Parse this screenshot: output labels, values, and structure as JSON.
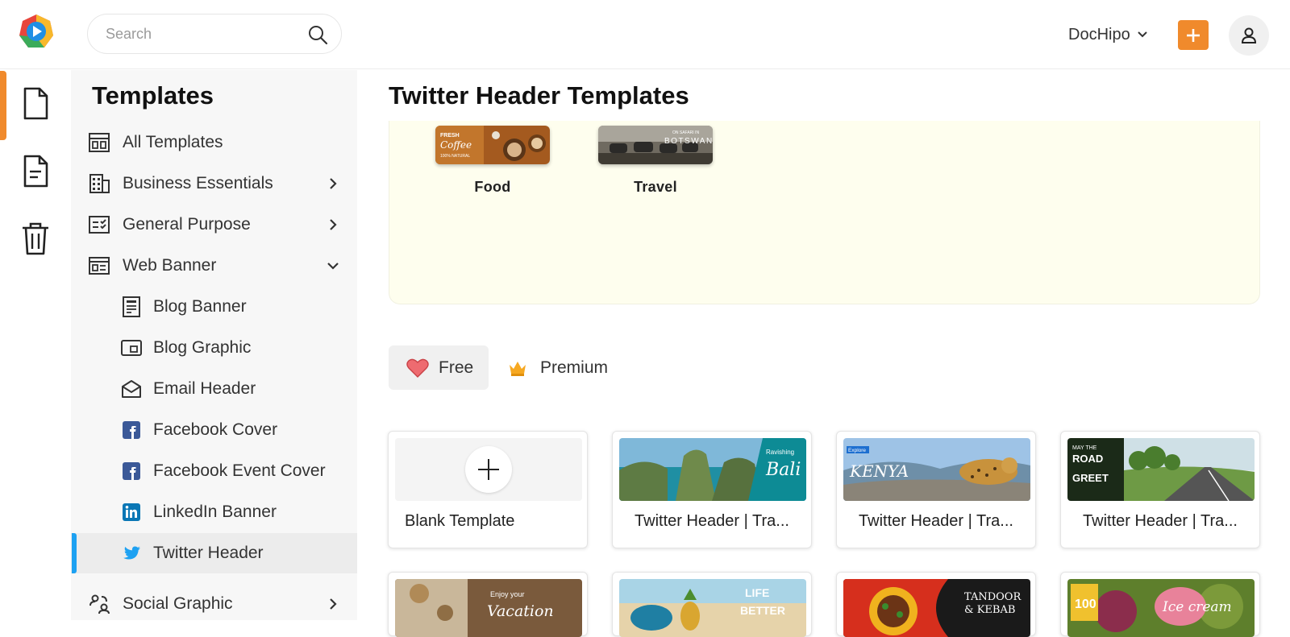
{
  "header": {
    "search_placeholder": "Search",
    "brand_menu": "DocHipo",
    "accent_color": "#f08a2c"
  },
  "sidebar": {
    "title": "Templates",
    "items": [
      {
        "label": "All Templates",
        "icon": "grid-icon"
      },
      {
        "label": "Business Essentials",
        "icon": "building-icon"
      },
      {
        "label": "General Purpose",
        "icon": "checklist-icon"
      },
      {
        "label": "Web Banner",
        "icon": "web-banner-icon"
      },
      {
        "label": "Blog Banner",
        "icon": "blog-banner-icon"
      },
      {
        "label": "Blog Graphic",
        "icon": "blog-graphic-icon"
      },
      {
        "label": "Email Header",
        "icon": "envelope-icon"
      },
      {
        "label": "Facebook Cover",
        "icon": "facebook-icon"
      },
      {
        "label": "Facebook Event Cover",
        "icon": "facebook-icon"
      },
      {
        "label": "LinkedIn Banner",
        "icon": "linkedin-icon"
      },
      {
        "label": "Twitter Header",
        "icon": "twitter-icon"
      },
      {
        "label": "Social Graphic",
        "icon": "social-graphic-icon"
      }
    ]
  },
  "main": {
    "title": "Twitter Header Templates",
    "categories": [
      {
        "label": "Food",
        "thumb_text": "FRESH Coffee"
      },
      {
        "label": "Travel",
        "thumb_text": "BOTSWANA"
      }
    ],
    "filters": {
      "free": "Free",
      "premium": "Premium"
    },
    "cards": [
      {
        "title": "Blank Template"
      },
      {
        "title": "Twitter Header | Tra...",
        "thumb_text": "Bali",
        "thumb_sub": "Ravishing"
      },
      {
        "title": "Twitter Header | Tra...",
        "thumb_text": "KENYA",
        "thumb_sub": "Explore"
      },
      {
        "title": "Twitter Header | Tra...",
        "thumb_text": "ROAD GREET",
        "thumb_sub": "MAY THE"
      }
    ],
    "second_row_thumbs": [
      {
        "thumb_text": "Vacation",
        "thumb_sub": "Enjoy your"
      },
      {
        "thumb_text": "LIFE BETTER"
      },
      {
        "thumb_text": "TANDOOR & KEBAB"
      },
      {
        "thumb_text": "Ice cream",
        "thumb_sub": "100"
      }
    ]
  }
}
